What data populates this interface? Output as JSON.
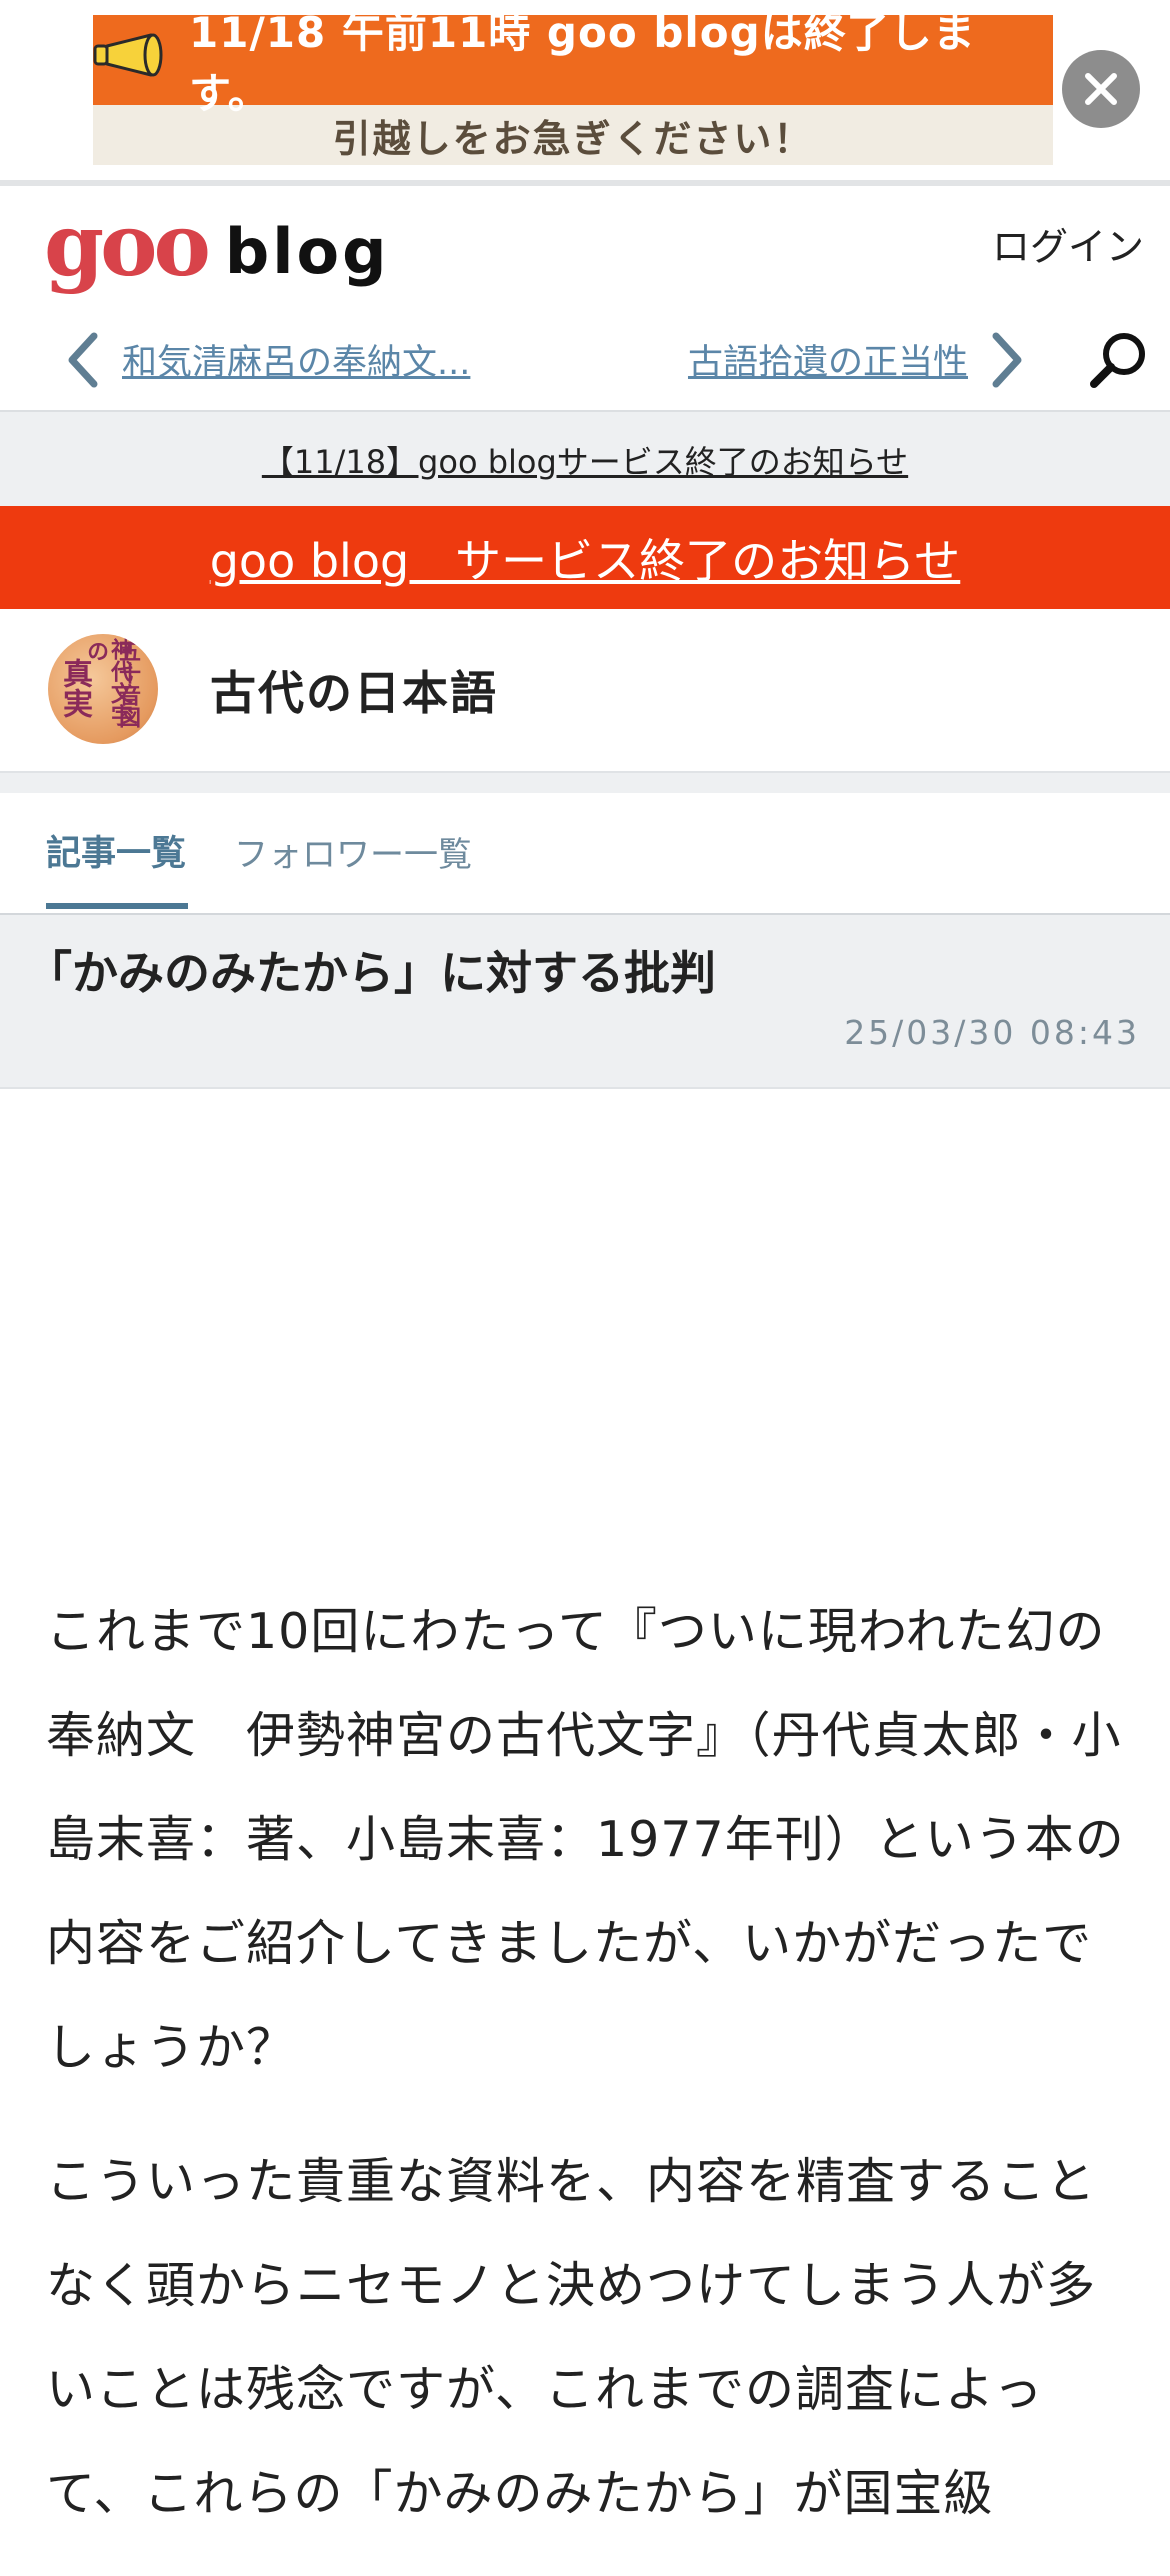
{
  "banner": {
    "line1": "11/18 午前11時 goo blogは終了します。",
    "line2": "引越しをお急ぎください！",
    "close_icon": "close-icon"
  },
  "header": {
    "logo_goo": "goo",
    "logo_blog": "blog",
    "login": "ログイン"
  },
  "article_nav": {
    "prev": "和気清麻呂の奉納文...",
    "next": "古語拾遺の正当性",
    "search_icon": "search-icon"
  },
  "notice": {
    "strip": "【11/18】goo blogサービス終了のお知らせ",
    "red_bar": "goo blog　サービス終了のお知らせ"
  },
  "blog": {
    "title": "古代の日本語"
  },
  "tabs": {
    "articles": "記事一覧",
    "followers": "フォロワー一覧"
  },
  "article": {
    "title": "「かみのみたから」に対する批判",
    "date": "25/03/30 08:43",
    "paragraphs": [
      "これまで10回にわたって『ついに現われた幻の奉納文　伊勢神宮の古代文字』（丹代貞太郎・小島末喜：著、小島末喜：1977年刊）という本の内容をご紹介してきましたが、いかがだったでしょうか？",
      "こういった貴重な資料を、内容を精査することなく頭からニセモノと決めつけてしまう人が多いことは残念ですが、これまでの調査によって、これらの「かみのみたから」が国宝級"
    ]
  },
  "colors": {
    "banner_orange": "#ee6a1e",
    "notice_red": "#ee3a0f",
    "logo_red": "#d8434a",
    "link_blue": "#5b86a8",
    "tab_active": "#4c7894"
  }
}
